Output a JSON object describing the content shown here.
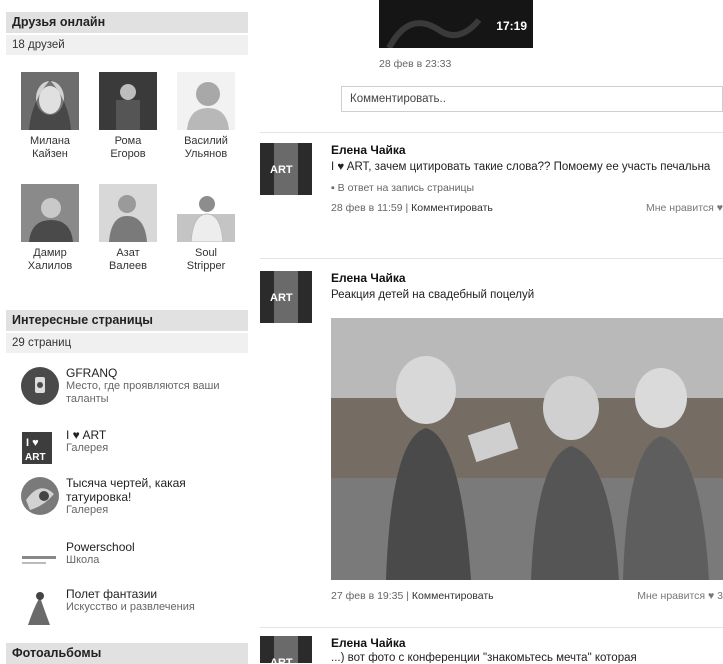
{
  "friends_online": {
    "title": "Друзья онлайн",
    "count": "18 друзей",
    "friends": [
      {
        "first": "Милана",
        "last": "Кайзен"
      },
      {
        "first": "Рома",
        "last": "Егоров"
      },
      {
        "first": "Василий",
        "last": "Ульянов"
      },
      {
        "first": "Дамир",
        "last": "Халилов"
      },
      {
        "first": "Азат",
        "last": "Валеев"
      },
      {
        "first": "Soul",
        "last": "Stripper"
      }
    ]
  },
  "interesting_pages": {
    "title": "Интересные страницы",
    "count": "29 страниц",
    "pages": [
      {
        "title": "GFRANQ",
        "subtitle": "Место, где проявляются ваши таланты"
      },
      {
        "title": "I ♥ ART",
        "subtitle": "Галерея"
      },
      {
        "title": "Тысяча чертей, какая татуировка!",
        "subtitle": "Галерея"
      },
      {
        "title": "Powerschool",
        "subtitle": "Школа"
      },
      {
        "title": "Полет фантазии",
        "subtitle": "Искусство и развлечения"
      }
    ]
  },
  "photo_albums": {
    "title": "Фотоальбомы"
  },
  "feed": {
    "top_post": {
      "video_time": "17:19",
      "date": "28 фев в 23:33",
      "comment_placeholder": "Комментировать.."
    },
    "posts": [
      {
        "author": "Елена Чайка",
        "text": "I ♥ ART, зачем цитировать такие слова?? Помоему ее участь печальна",
        "reply": "В ответ на запись страницы",
        "date": "28 фев в 11:59",
        "comment": "Комментировать",
        "like": "Мне нравится"
      },
      {
        "author": "Елена Чайка",
        "text": "Реакция детей на свадебный поцелуй",
        "date": "27 фев в 19:35",
        "comment": "Комментировать",
        "like": "Мне нравится",
        "like_count": "3"
      },
      {
        "author": "Елена Чайка",
        "text": "...) вот фото с конференции \"знакомьтесь мечта\" которая"
      }
    ],
    "separator": "|"
  },
  "colors": {
    "header_bg": "#e1e1e1",
    "sub_bg": "#f0f0f0",
    "page_bg": "#ffffff"
  }
}
